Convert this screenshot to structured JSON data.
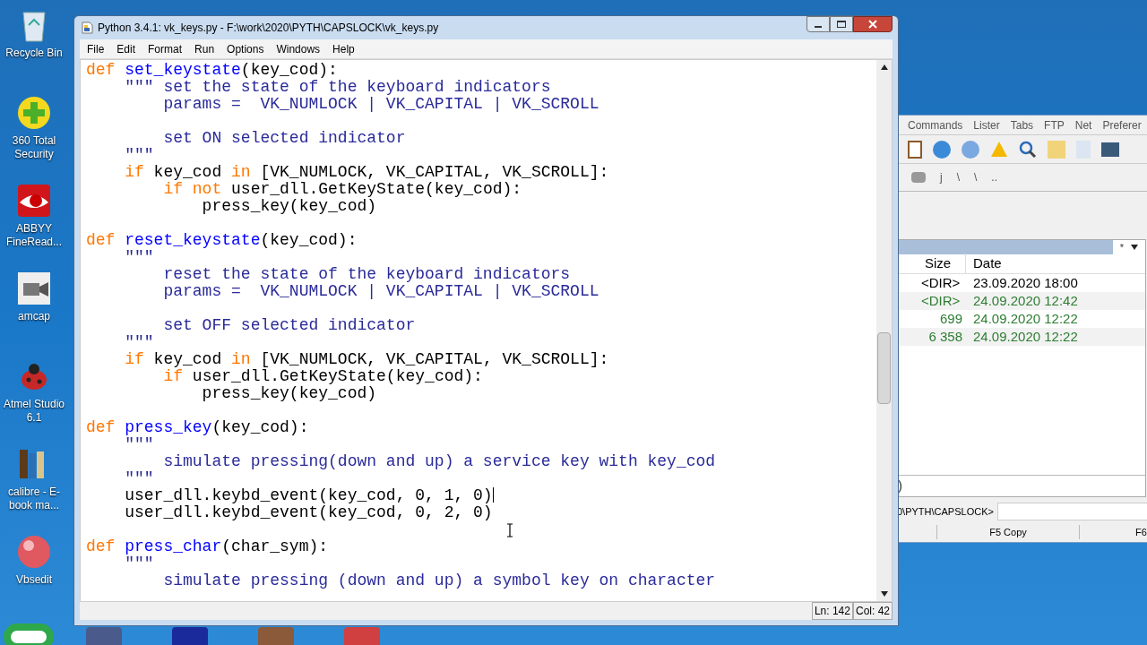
{
  "desktop_icons": [
    {
      "label": "Recycle Bin",
      "kind": "bin"
    },
    {
      "label": "360 Total Security",
      "kind": "plus"
    },
    {
      "label": "ABBYY FineRead...",
      "kind": "eye"
    },
    {
      "label": "amcap",
      "kind": "camera"
    },
    {
      "label": "Atmel Studio 6.1",
      "kind": "bug"
    },
    {
      "label": "calibre - E-book ma...",
      "kind": "books"
    },
    {
      "label": "Vbsedit",
      "kind": "ball"
    }
  ],
  "editor": {
    "title": "Python 3.4.1: vk_keys.py - F:\\work\\2020\\PYTH\\CAPSLOCK\\vk_keys.py",
    "menu": [
      "File",
      "Edit",
      "Format",
      "Run",
      "Options",
      "Windows",
      "Help"
    ],
    "blocks": [
      [
        {
          "caret": false,
          "tokens": [
            {
              "kind": "keyword",
              "t": "def"
            },
            {
              "kind": "name",
              "t": " set_keystate"
            },
            {
              "kind": "plain",
              "t": "(key_cod):"
            }
          ]
        },
        {
          "caret": false,
          "tokens": [
            {
              "kind": "string",
              "t": "    \"\"\" set the state of the keyboard indicators"
            }
          ]
        },
        {
          "caret": false,
          "tokens": [
            {
              "kind": "string",
              "t": "        params =  VK_NUMLOCK | VK_CAPITAL | VK_SCROLL"
            }
          ]
        }
      ],
      [
        {
          "caret": false,
          "tokens": [
            {
              "kind": "string",
              "t": "        set ON selected indicator"
            }
          ]
        },
        {
          "caret": false,
          "tokens": [
            {
              "kind": "string",
              "t": "    \"\"\""
            }
          ]
        },
        {
          "caret": false,
          "tokens": [
            {
              "kind": "keyword",
              "t": "    if"
            },
            {
              "kind": "plain",
              "t": " key_cod "
            },
            {
              "kind": "keyword",
              "t": "in"
            },
            {
              "kind": "plain",
              "t": " [VK_NUMLOCK, VK_CAPITAL, VK_SCROLL]:"
            }
          ]
        },
        {
          "caret": false,
          "tokens": [
            {
              "kind": "keyword",
              "t": "        if not"
            },
            {
              "kind": "plain",
              "t": " user_dll.GetKeyState(key_cod):"
            }
          ]
        },
        {
          "caret": false,
          "tokens": [
            {
              "kind": "plain",
              "t": "            press_key(key_cod)"
            }
          ]
        }
      ],
      [
        {
          "caret": false,
          "tokens": [
            {
              "kind": "keyword",
              "t": "def"
            },
            {
              "kind": "name",
              "t": " reset_keystate"
            },
            {
              "kind": "plain",
              "t": "(key_cod):"
            }
          ]
        },
        {
          "caret": false,
          "tokens": [
            {
              "kind": "string",
              "t": "    \"\"\""
            }
          ]
        },
        {
          "caret": false,
          "tokens": [
            {
              "kind": "string",
              "t": "        reset the state of the keyboard indicators"
            }
          ]
        },
        {
          "caret": false,
          "tokens": [
            {
              "kind": "string",
              "t": "        params =  VK_NUMLOCK | VK_CAPITAL | VK_SCROLL"
            }
          ]
        }
      ],
      [
        {
          "caret": false,
          "tokens": [
            {
              "kind": "string",
              "t": "        set OFF selected indicator"
            }
          ]
        },
        {
          "caret": false,
          "tokens": [
            {
              "kind": "string",
              "t": "    \"\"\""
            }
          ]
        },
        {
          "caret": false,
          "tokens": [
            {
              "kind": "keyword",
              "t": "    if"
            },
            {
              "kind": "plain",
              "t": " key_cod "
            },
            {
              "kind": "keyword",
              "t": "in"
            },
            {
              "kind": "plain",
              "t": " [VK_NUMLOCK, VK_CAPITAL, VK_SCROLL]:"
            }
          ]
        },
        {
          "caret": false,
          "tokens": [
            {
              "kind": "keyword",
              "t": "        if"
            },
            {
              "kind": "plain",
              "t": " user_dll.GetKeyState(key_cod):"
            }
          ]
        },
        {
          "caret": false,
          "tokens": [
            {
              "kind": "plain",
              "t": "            press_key(key_cod)"
            }
          ]
        }
      ],
      [
        {
          "caret": false,
          "tokens": [
            {
              "kind": "keyword",
              "t": "def"
            },
            {
              "kind": "name",
              "t": " press_key"
            },
            {
              "kind": "plain",
              "t": "(key_cod):"
            }
          ]
        },
        {
          "caret": false,
          "tokens": [
            {
              "kind": "string",
              "t": "    \"\"\""
            }
          ]
        },
        {
          "caret": false,
          "tokens": [
            {
              "kind": "string",
              "t": "        simulate pressing(down and up) a service key with key_cod"
            }
          ]
        },
        {
          "caret": false,
          "tokens": [
            {
              "kind": "string",
              "t": "    \"\"\""
            }
          ]
        },
        {
          "caret": true,
          "tokens": [
            {
              "kind": "plain",
              "t": "    user_dll.keybd_event(key_cod, 0, 1, 0)"
            }
          ]
        },
        {
          "caret": false,
          "tokens": [
            {
              "kind": "plain",
              "t": "    user_dll.keybd_event(key_cod, 0, 2, 0)"
            }
          ]
        }
      ],
      [
        {
          "caret": false,
          "tokens": [
            {
              "kind": "keyword",
              "t": "def"
            },
            {
              "kind": "name",
              "t": " press_char"
            },
            {
              "kind": "plain",
              "t": "(char_sym):"
            }
          ]
        },
        {
          "caret": false,
          "tokens": [
            {
              "kind": "string",
              "t": "    \"\"\""
            }
          ]
        },
        {
          "caret": false,
          "tokens": [
            {
              "kind": "string",
              "t": "        simulate pressing (down and up) a symbol key on character"
            }
          ]
        }
      ]
    ],
    "status": [
      "Ln: 142",
      "Col: 42"
    ]
  },
  "commander": {
    "menu": [
      "Commands",
      "Lister",
      "Tabs",
      "FTP",
      "Net",
      "Preferer"
    ],
    "path_items": [
      "j",
      "\\",
      "\\",
      ".."
    ],
    "filter": "*",
    "columns": [
      "Size",
      "Date"
    ],
    "rows": [
      {
        "size": "<DIR>",
        "date": "23.09.2020 18:00",
        "color": "#000000"
      },
      {
        "size": "<DIR>",
        "date": "24.09.2020 12:42",
        "color": "#2e7d32"
      },
      {
        "size": "699",
        "date": "24.09.2020 12:22",
        "color": "#2e7d32"
      },
      {
        "size": "6 358",
        "date": "24.09.2020 12:22",
        "color": "#2e7d32"
      }
    ],
    "panel_status": ")",
    "command_path": "0\\PYTH\\CAPSLOCK>",
    "function_keys": [
      "F5 Copy",
      "F6"
    ]
  }
}
